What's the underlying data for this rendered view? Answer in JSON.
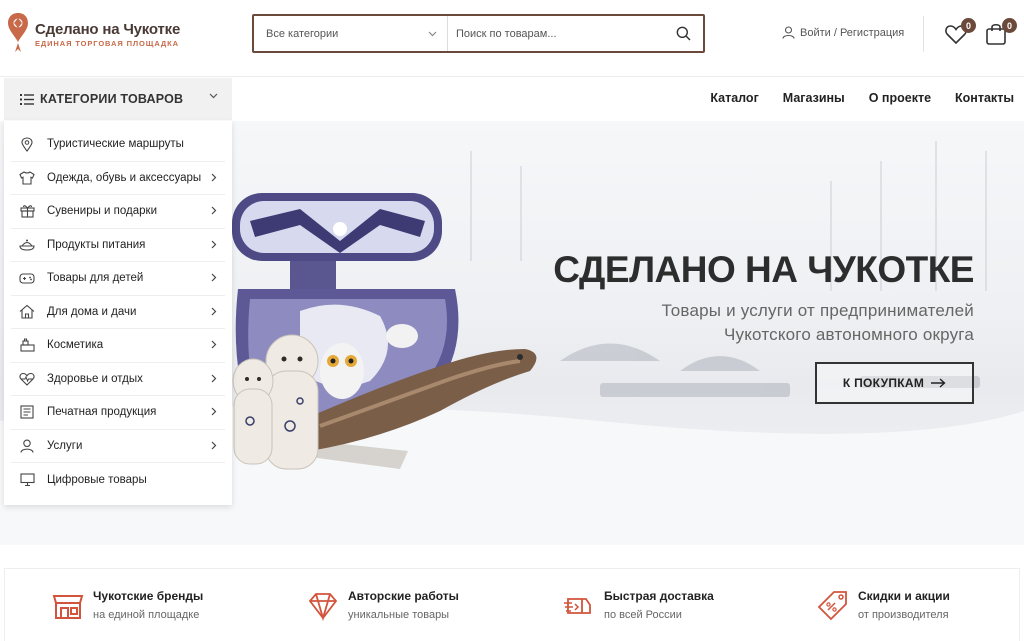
{
  "brand": {
    "title": "Сделано на Чукотке",
    "subtitle": "Единая торговая площадка",
    "accent": "#c86a4a",
    "dark": "#6b4a3c"
  },
  "search": {
    "category_label": "Все категории",
    "placeholder": "Поиск по товарам..."
  },
  "header": {
    "login_label": "Войти / Регистрация",
    "wishlist_count": "0",
    "cart_count": "0"
  },
  "category_toggle": {
    "label": "КАТЕГОРИИ ТОВАРОВ"
  },
  "nav": [
    {
      "label": "Каталог"
    },
    {
      "label": "Магазины"
    },
    {
      "label": "О проекте"
    },
    {
      "label": "Контакты"
    }
  ],
  "categories": [
    {
      "label": "Туристические маршруты",
      "icon": "map-pin-icon",
      "has_sub": false
    },
    {
      "label": "Одежда, обувь и аксессуары",
      "icon": "shirt-icon",
      "has_sub": true
    },
    {
      "label": "Сувениры и подарки",
      "icon": "gift-icon",
      "has_sub": true
    },
    {
      "label": "Продукты питания",
      "icon": "food-icon",
      "has_sub": true
    },
    {
      "label": "Товары для детей",
      "icon": "gamepad-icon",
      "has_sub": true
    },
    {
      "label": "Для дома и дачи",
      "icon": "home-icon",
      "has_sub": true
    },
    {
      "label": "Косметика",
      "icon": "cosmetics-icon",
      "has_sub": true
    },
    {
      "label": "Здоровье и отдых",
      "icon": "heart-pulse-icon",
      "has_sub": true
    },
    {
      "label": "Печатная продукция",
      "icon": "newspaper-icon",
      "has_sub": true
    },
    {
      "label": "Услуги",
      "icon": "user-icon",
      "has_sub": true
    },
    {
      "label": "Цифровые товары",
      "icon": "monitor-icon",
      "has_sub": false
    }
  ],
  "hero": {
    "title": "СДЕЛАНО НА ЧУКОТКЕ",
    "subtitle_line1": "Товары и услуги от предпринимателей",
    "subtitle_line2": "Чукотского автономного округа",
    "button_label": "К ПОКУПКАМ"
  },
  "features": [
    {
      "title": "Чукотские бренды",
      "subtitle": "на единой площадке",
      "icon": "shop-icon"
    },
    {
      "title": "Авторские работы",
      "subtitle": "уникальные товары",
      "icon": "diamond-icon"
    },
    {
      "title": "Быстрая доставка",
      "subtitle": "по всей России",
      "icon": "delivery-icon"
    },
    {
      "title": "Скидки и акции",
      "subtitle": "от производителя",
      "icon": "discount-tag-icon"
    }
  ]
}
